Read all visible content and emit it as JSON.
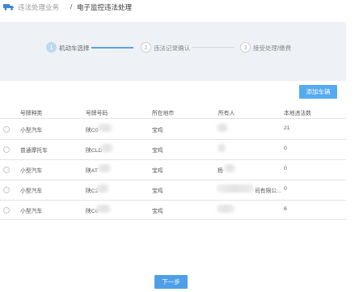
{
  "breadcrumb": {
    "section": "违法处理业务",
    "separator": "/",
    "current": "电子监控违法处理"
  },
  "steps": [
    {
      "number": "1",
      "label": "机动车选择",
      "state": "active"
    },
    {
      "number": "2",
      "label": "违法记录确认",
      "state": "inactive"
    },
    {
      "number": "3",
      "label": "接受处理/缴费",
      "state": "inactive"
    }
  ],
  "add_vehicle_label": "添加车辆",
  "table": {
    "columns": [
      "号牌种类",
      "号牌号码",
      "所在地市",
      "所有人",
      "本地违法数"
    ],
    "rows": [
      {
        "type": "小型汽车",
        "plate": "陕C0",
        "city": "宝鸡",
        "owner": "",
        "count": "21"
      },
      {
        "type": "普通摩托车",
        "plate": "陕CLD",
        "city": "宝鸡",
        "owner": "",
        "count": "0"
      },
      {
        "type": "小型汽车",
        "plate": "陕AT",
        "city": "宝鸡",
        "owner": "杨",
        "count": "0"
      },
      {
        "type": "小型汽车",
        "plate": "陕C2",
        "city": "宝鸡",
        "owner": "司有限公...",
        "count": "0"
      },
      {
        "type": "小型汽车",
        "plate": "陕C0",
        "city": "宝鸡",
        "owner": "",
        "count": "6"
      }
    ]
  },
  "next_label": "下一步",
  "colors": {
    "accent": "#55aaf0",
    "step_active": "#bcd9ee",
    "band": "#eef1f5"
  }
}
